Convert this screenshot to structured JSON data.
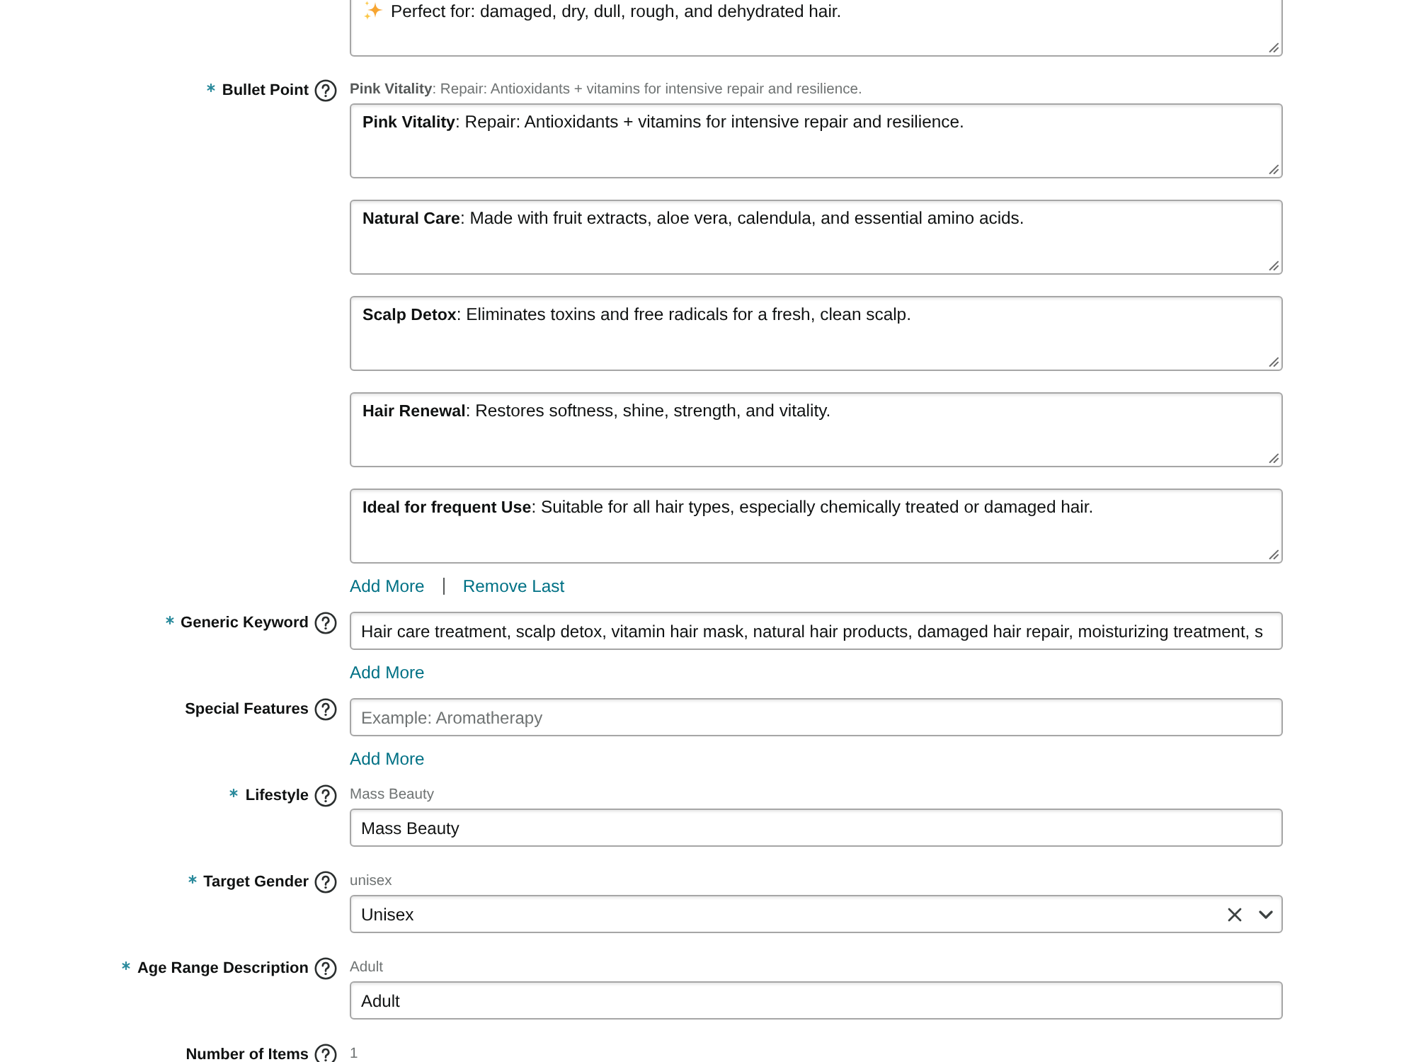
{
  "top_field": {
    "value": "Perfect for: damaged, dry, dull, rough, and dehydrated hair."
  },
  "fields": [
    {
      "kind": "textarea_list",
      "label": "Bullet Point",
      "required": true,
      "hint": "**Pink Vitality**: Repair: Antioxidants + vitamins for intensive repair and resilience.",
      "values": [
        "**Pink Vitality**: Repair: Antioxidants + vitamins for intensive repair and resilience.",
        "**Natural Care**: Made with fruit extracts, aloe vera, calendula, and essential amino acids.",
        "**Scalp Detox**: Eliminates toxins and free radicals for a fresh, clean scalp.",
        "**Hair Renewal**: Restores softness, shine, strength, and vitality.",
        "**Ideal for frequent Use**: Suitable for all hair types, especially chemically treated or damaged hair."
      ],
      "links": [
        {
          "kind": "add",
          "label": "Add More"
        },
        {
          "kind": "remove",
          "label": "Remove Last"
        }
      ]
    },
    {
      "kind": "input",
      "label": "Generic Keyword",
      "required": true,
      "value": "Hair care treatment, scalp detox, vitamin hair mask, natural hair products, damaged hair repair, moisturizing treatment, s",
      "links": [
        {
          "kind": "add",
          "label": "Add More"
        }
      ]
    },
    {
      "kind": "input",
      "label": "Special Features",
      "required": false,
      "placeholder": "Example: Aromatherapy",
      "links": [
        {
          "kind": "add",
          "label": "Add More"
        }
      ]
    },
    {
      "kind": "input",
      "label": "Lifestyle",
      "required": true,
      "hint": "Mass Beauty",
      "value": "Mass Beauty"
    },
    {
      "kind": "select",
      "label": "Target Gender",
      "required": true,
      "hint": "unisex",
      "value": "Unisex",
      "clearable": true
    },
    {
      "kind": "input",
      "label": "Age Range Description",
      "required": true,
      "hint": "Adult",
      "value": "Adult"
    },
    {
      "kind": "label_only",
      "label": "Number of Items",
      "required": false,
      "hint": "1"
    }
  ]
}
